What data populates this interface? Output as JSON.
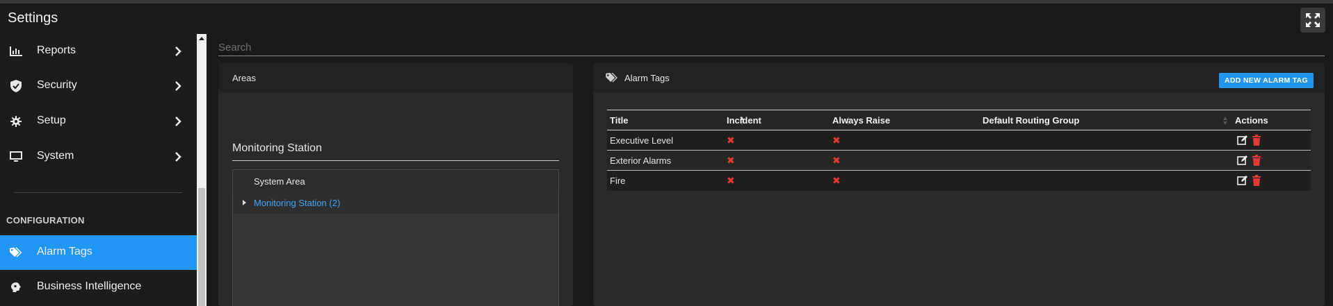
{
  "app": {
    "title": "Settings"
  },
  "sidebar": {
    "items": [
      {
        "label": "Reports",
        "icon": "bar-chart-icon"
      },
      {
        "label": "Security",
        "icon": "shield-check-icon"
      },
      {
        "label": "Setup",
        "icon": "gear-icon"
      },
      {
        "label": "System",
        "icon": "monitor-icon"
      }
    ],
    "section_title": "CONFIGURATION",
    "config_items": [
      {
        "label": "Alarm Tags",
        "icon": "tags-icon",
        "active": true
      },
      {
        "label": "Business Intelligence",
        "icon": "brain-icon",
        "active": false
      }
    ]
  },
  "search": {
    "placeholder": "Search",
    "value": ""
  },
  "areas_panel": {
    "title": "Areas",
    "station_heading": "Monitoring Station",
    "tree_header": "System Area",
    "tree_node": "Monitoring Station (2)"
  },
  "tags_panel": {
    "title": "Alarm Tags",
    "add_button": "ADD NEW ALARM TAG",
    "columns": [
      "Title",
      "Incident",
      "Always Raise",
      "Default Routing Group",
      "Actions"
    ],
    "rows": [
      {
        "title": "Executive Level",
        "incident": false,
        "always_raise": false,
        "routing_group": ""
      },
      {
        "title": "Exterior Alarms",
        "incident": false,
        "always_raise": false,
        "routing_group": ""
      },
      {
        "title": "Fire",
        "incident": false,
        "always_raise": false,
        "routing_group": ""
      }
    ]
  },
  "colors": {
    "accent": "#2196f3",
    "link": "#42a5f5",
    "danger": "#e53935"
  }
}
